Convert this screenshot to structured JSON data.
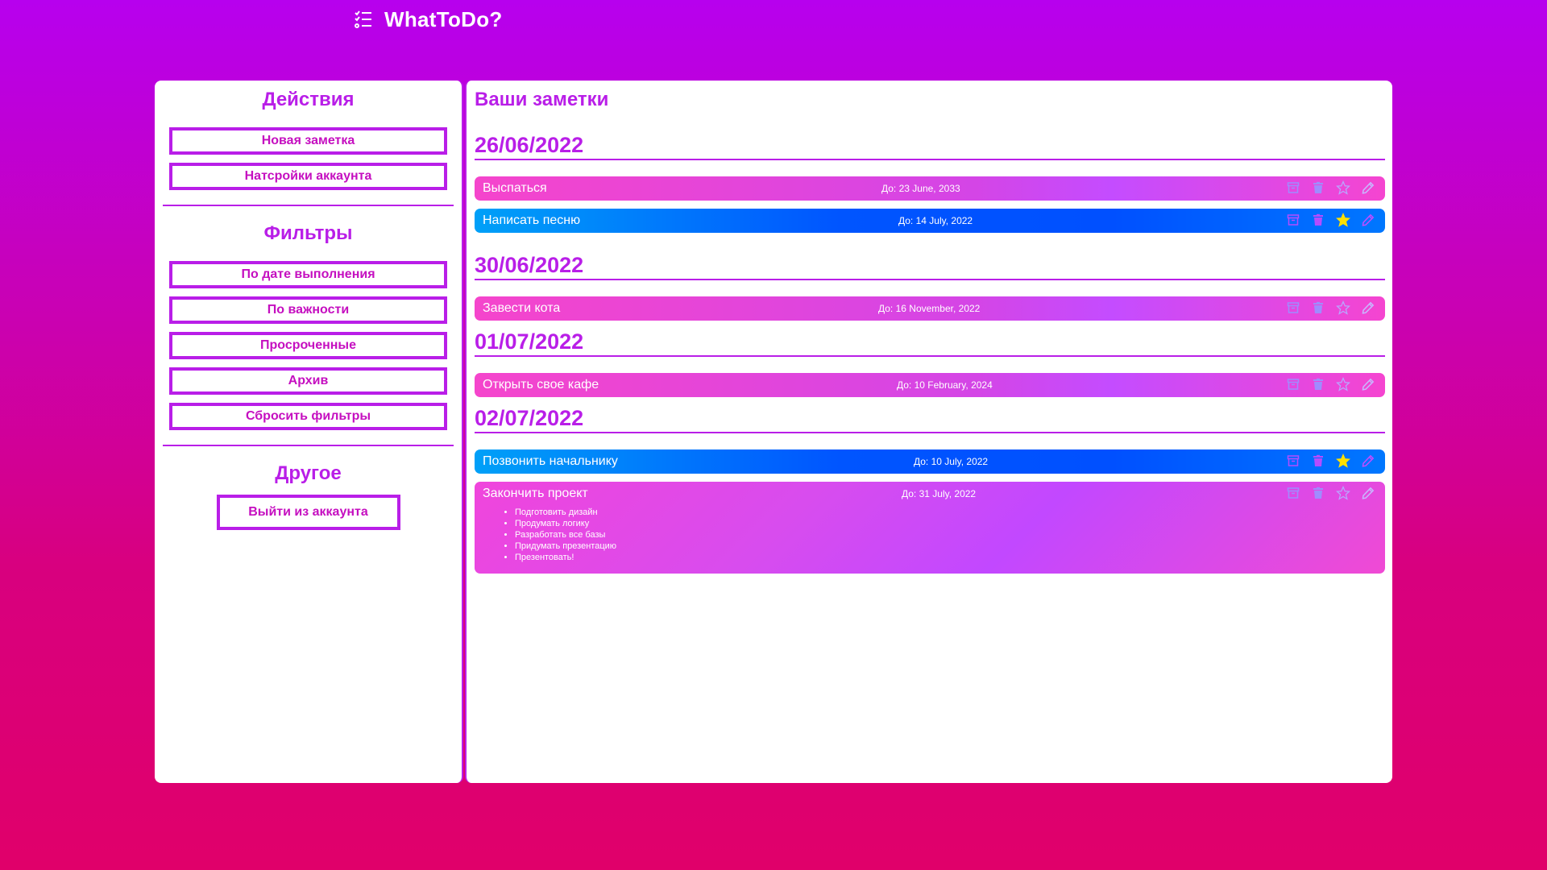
{
  "app": {
    "title": "WhatToDo?",
    "logo_icon": "checklist-icon"
  },
  "colors": {
    "accent": "#b91ee8",
    "button_text": "#c50fc0",
    "star_active": "#ffe000"
  },
  "sidebar": {
    "actions_title": "Действия",
    "actions": [
      "Новая заметка",
      "Натсройки аккаунта"
    ],
    "filters_title": "Фильтры",
    "filters": [
      "По дате выполнения",
      "По важности",
      "Просроченные",
      "Архив",
      "Сбросить фильтры"
    ],
    "other_title": "Другое",
    "logout_label": "Выйти из аккаунта"
  },
  "main": {
    "title": "Ваши заметки",
    "groups": [
      {
        "date": "26/06/2022",
        "notes": [
          {
            "title": "Выспаться",
            "due": "До: 23 June, 2033",
            "style": "pink",
            "starred": false
          },
          {
            "title": "Написать песню",
            "due": "До: 14 July, 2022",
            "style": "blue",
            "starred": true
          }
        ]
      },
      {
        "date": "30/06/2022",
        "notes": [
          {
            "title": "Завести кота",
            "due": "До: 16 November, 2022",
            "style": "pink",
            "starred": false
          }
        ]
      },
      {
        "date": "01/07/2022",
        "notes": [
          {
            "title": "Открыть свое кафе",
            "due": "До: 10 February, 2024",
            "style": "pink",
            "starred": false
          }
        ]
      },
      {
        "date": "02/07/2022",
        "notes": [
          {
            "title": "Позвонить начальнику",
            "due": "До: 10 July, 2022",
            "style": "blue",
            "starred": true
          },
          {
            "title": "Закончить проект",
            "due": "До: 31 July, 2022",
            "style": "pink",
            "starred": false,
            "subtasks": [
              "Подготовить дизайн",
              "Продумать логику",
              "Разработать все базы",
              "Придумать презентацию",
              "Презентовать!"
            ]
          }
        ]
      }
    ]
  }
}
